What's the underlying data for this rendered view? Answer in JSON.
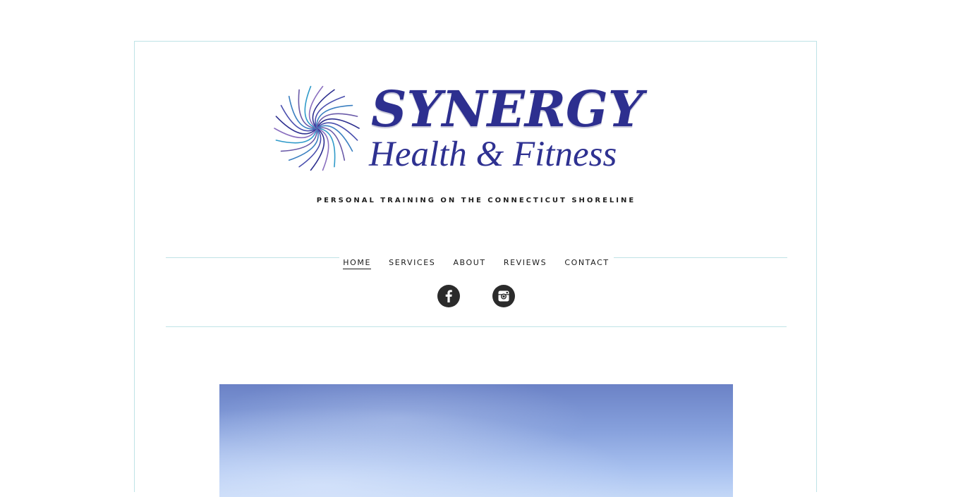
{
  "site": {
    "logo": {
      "title": "SYNERGY",
      "subtitle": "Health & Fitness"
    },
    "tagline": "PERSONAL TRAINING ON THE CONNECTICUT SHORELINE"
  },
  "nav": {
    "items": [
      {
        "label": "HOME",
        "active": true
      },
      {
        "label": "SERVICES"
      },
      {
        "label": "ABOUT"
      },
      {
        "label": "REVIEWS"
      },
      {
        "label": "CONTACT"
      }
    ]
  },
  "social": {
    "icons": [
      "facebook-icon",
      "instagram-icon"
    ]
  },
  "colors": {
    "brand_navy": "#2d2f8f",
    "frame_border": "#bfe3e6",
    "social_icon": "#2b2b2b",
    "sky_top": "#6b82c6",
    "sky_bottom": "#c3d7f7"
  }
}
